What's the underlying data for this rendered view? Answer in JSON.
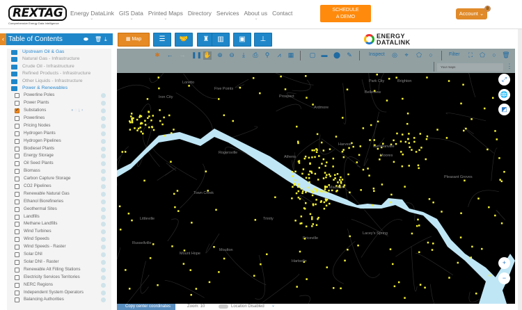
{
  "header": {
    "logo": "REXTAG",
    "logo_tagline": "Comprehensive Energy Data Intelligence",
    "nav": [
      "Energy DataLink",
      "GIS Data",
      "Printed Maps",
      "Directory",
      "Services",
      "About us",
      "Contact"
    ],
    "demo_line1": "SCHEDULE",
    "demo_line2": "A DEMO",
    "account": "Account",
    "account_badge": "8"
  },
  "toc": {
    "title": "Table of Contents",
    "groups": [
      "Upstream Oil & Gas",
      "Natural Gas - Infrastructure",
      "Crude Oil - Infrastructure",
      "Refined Products - Infrastructure",
      "Other Liquids - Infrastructure",
      "Power & Renewables"
    ],
    "layers": [
      {
        "label": "Powerline Poles",
        "checked": false
      },
      {
        "label": "Power Plants",
        "checked": false
      },
      {
        "label": "Substations",
        "checked": true
      },
      {
        "label": "Powerlines",
        "checked": false
      },
      {
        "label": "Pricing Nodes",
        "checked": false
      },
      {
        "label": "Hydrogen Plants",
        "checked": false
      },
      {
        "label": "Hydrogen Pipelines",
        "checked": false
      },
      {
        "label": "Biodiesel Plants",
        "checked": false
      },
      {
        "label": "Energy Storage",
        "checked": false
      },
      {
        "label": "Oil Seed Plants",
        "checked": false
      },
      {
        "label": "Biomass",
        "checked": false
      },
      {
        "label": "Carbon Capture Storage",
        "checked": false
      },
      {
        "label": "CO2 Pipelines",
        "checked": false
      },
      {
        "label": "Renewable Natural Gas",
        "checked": false
      },
      {
        "label": "Ethanol Biorefineries",
        "checked": false
      },
      {
        "label": "Geothermal Sites",
        "checked": false
      },
      {
        "label": "Landfills",
        "checked": false
      },
      {
        "label": "Methane Landfills",
        "checked": false
      },
      {
        "label": "Wind Turbines",
        "checked": false
      },
      {
        "label": "Wind Speeds",
        "checked": false
      },
      {
        "label": "Wind Speeds - Raster",
        "checked": false
      },
      {
        "label": "Solar DNI",
        "checked": false
      },
      {
        "label": "Solar DNI - Raster",
        "checked": false
      },
      {
        "label": "Renewable Alt Filling Stations",
        "checked": false
      },
      {
        "label": "Electricity Services Territories",
        "checked": false
      },
      {
        "label": "NERC Regions",
        "checked": false
      },
      {
        "label": "Independent System Operators",
        "checked": false
      },
      {
        "label": "Balancing Authorities",
        "checked": false
      }
    ]
  },
  "modules": {
    "map": "Map"
  },
  "brand": {
    "line1": "ENERGY",
    "line2": "DATALINK"
  },
  "map_toolbar": {
    "inspect": "Inspect",
    "filter": "Filter",
    "your_maps": "Your maps"
  },
  "map": {
    "places": [
      "Loretto",
      "Five Points",
      "Iron City",
      "Prospect",
      "Ardmore",
      "Park City",
      "Brighton",
      "Belleview",
      "Rogersville",
      "Harvest",
      "Meridianville",
      "Moores",
      "Madison",
      "Town Creek",
      "Trinity",
      "Priceville",
      "Littleville",
      "Russellville",
      "Moulton",
      "Mount Hope",
      "Hartselle",
      "Lacey's Spring",
      "Pleasant Groves",
      "Athens"
    ],
    "colors": {
      "background": "#000000",
      "water": "#bfe6f5",
      "substation": "#f5f233"
    }
  },
  "status": {
    "copy": "Copy center coordinates",
    "zoom": "Zoom: 10",
    "location": "Location Disabled"
  }
}
